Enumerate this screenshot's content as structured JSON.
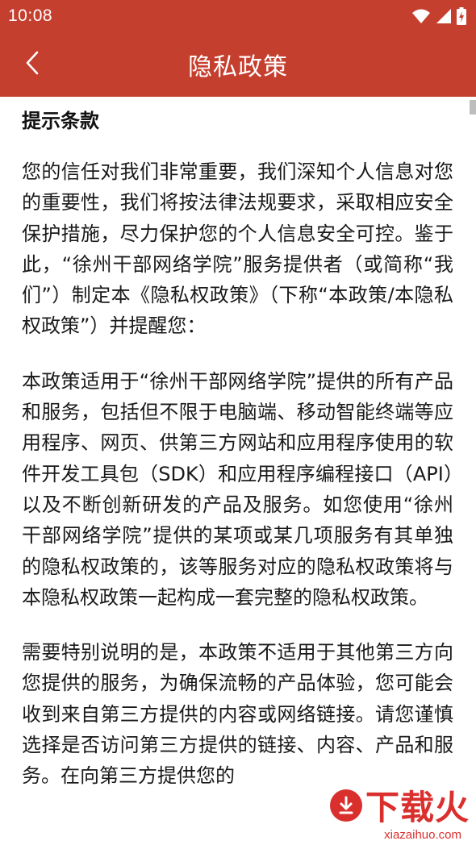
{
  "status_bar": {
    "time": "10:08"
  },
  "app_bar": {
    "title": "隐私政策",
    "back_icon": "chevron-left-icon"
  },
  "content": {
    "heading": "提示条款",
    "paragraphs": [
      "您的信任对我们非常重要，我们深知个人信息对您的重要性，我们将按法律法规要求，采取相应安全保护措施，尽力保护您的个人信息安全可控。鉴于此，“徐州干部网络学院”服务提供者（或简称“我们”）制定本《隐私权政策》（下称“本政策/本隐私权政策”）并提醒您：",
      "本政策适用于“徐州干部网络学院”提供的所有产品和服务，包括但不限于电脑端、移动智能终端等应用程序、网页、供第三方网站和应用程序使用的软件开发工具包（SDK）和应用程序编程接口（API）以及不断创新研发的产品及服务。如您使用“徐州干部网络学院”提供的某项或某几项服务有其单独的隐私权政策的，该等服务对应的隐私权政策将与本隐私权政策一起构成一套完整的隐私权政策。",
      "需要特别说明的是，本政策不适用于其他第三方向您提供的服务，为确保流畅的产品体验，您可能会收到来自第三方提供的内容或网络链接。请您谨慎选择是否访问第三方提供的链接、内容、产品和服务。在向第三方提供您的"
    ]
  },
  "watermark": {
    "brand": "下载火",
    "domain": "xiazaihuo.com"
  },
  "colors": {
    "primary": "#c53f2f",
    "text": "#1a1a1a",
    "watermark": "#d9302e"
  }
}
